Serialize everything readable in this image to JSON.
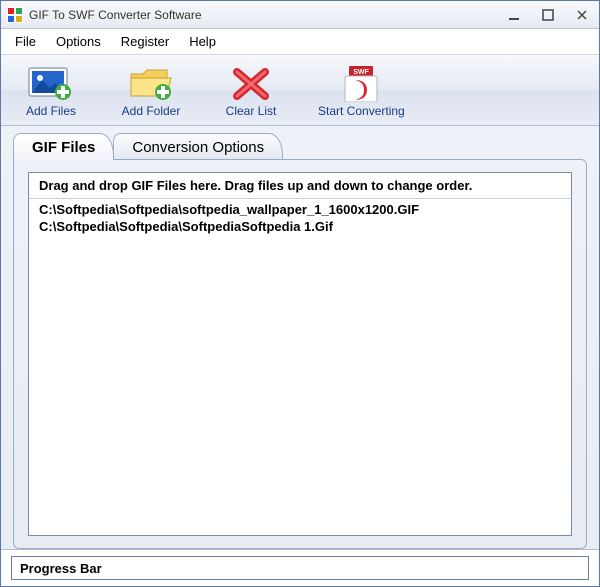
{
  "window": {
    "title": "GIF To SWF Converter Software"
  },
  "menu": {
    "file": "File",
    "options": "Options",
    "register": "Register",
    "help": "Help"
  },
  "toolbar": {
    "addFiles": "Add Files",
    "addFolder": "Add Folder",
    "clearList": "Clear List",
    "startConverting": "Start Converting"
  },
  "tabs": {
    "gifFiles": "GIF Files",
    "conversionOptions": "Conversion Options"
  },
  "list": {
    "header": "Drag and drop GIF Files here. Drag files up and down to change order.",
    "items": [
      "C:\\Softpedia\\Softpedia\\softpedia_wallpaper_1_1600x1200.GIF",
      "C:\\Softpedia\\Softpedia\\SoftpediaSoftpedia 1.Gif"
    ]
  },
  "progress": {
    "label": "Progress Bar"
  }
}
